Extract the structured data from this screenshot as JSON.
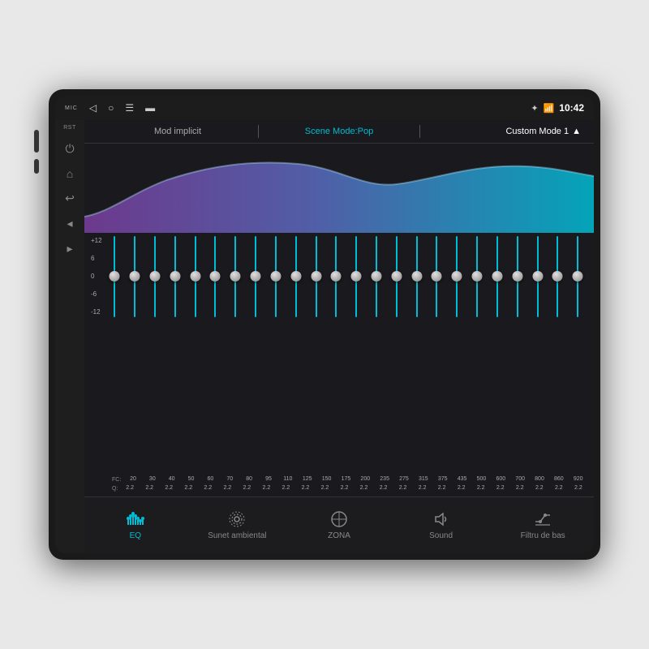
{
  "device": {
    "background": "#1a1a1a"
  },
  "status_bar": {
    "mic": "MIC",
    "time": "10:42",
    "nav_icons": [
      "◁",
      "○",
      "☰",
      "▬"
    ],
    "status_icons": [
      "✦",
      "☁",
      "📶"
    ]
  },
  "mode_bar": {
    "left": "Mod implicit",
    "center": "Scene Mode:Pop",
    "right": "Custom Mode 1",
    "right_arrow": "▲"
  },
  "left_sidebar": {
    "rst": "RST",
    "icons": [
      "⏻",
      "⌂",
      "↩",
      "↔",
      "↕"
    ]
  },
  "eq": {
    "db_labels": [
      "+12",
      "6",
      "0",
      "-6",
      "-12"
    ],
    "bands": [
      {
        "freq": "20",
        "q": "2.2",
        "position": 50
      },
      {
        "freq": "30",
        "q": "2.2",
        "position": 50
      },
      {
        "freq": "40",
        "q": "2.2",
        "position": 50
      },
      {
        "freq": "50",
        "q": "2.2",
        "position": 50
      },
      {
        "freq": "60",
        "q": "2.2",
        "position": 50
      },
      {
        "freq": "70",
        "q": "2.2",
        "position": 50
      },
      {
        "freq": "80",
        "q": "2.2",
        "position": 50
      },
      {
        "freq": "95",
        "q": "2.2",
        "position": 50
      },
      {
        "freq": "110",
        "q": "2.2",
        "position": 50
      },
      {
        "freq": "125",
        "q": "2.2",
        "position": 50
      },
      {
        "freq": "150",
        "q": "2.2",
        "position": 50
      },
      {
        "freq": "175",
        "q": "2.2",
        "position": 50
      },
      {
        "freq": "200",
        "q": "2.2",
        "position": 50
      },
      {
        "freq": "235",
        "q": "2.2",
        "position": 50
      },
      {
        "freq": "275",
        "q": "2.2",
        "position": 50
      },
      {
        "freq": "315",
        "q": "2.2",
        "position": 50
      },
      {
        "freq": "375",
        "q": "2.2",
        "position": 50
      },
      {
        "freq": "435",
        "q": "2.2",
        "position": 50
      },
      {
        "freq": "500",
        "q": "2.2",
        "position": 50
      },
      {
        "freq": "600",
        "q": "2.2",
        "position": 50
      },
      {
        "freq": "700",
        "q": "2.2",
        "position": 50
      },
      {
        "freq": "800",
        "q": "2.2",
        "position": 50
      },
      {
        "freq": "860",
        "q": "2.2",
        "position": 50
      },
      {
        "freq": "920",
        "q": "2.2",
        "position": 50
      }
    ]
  },
  "bottom_nav": {
    "tabs": [
      {
        "id": "eq",
        "label": "EQ",
        "icon": "eq",
        "active": true
      },
      {
        "id": "ambient",
        "label": "Sunet ambiental",
        "icon": "ambient",
        "active": false
      },
      {
        "id": "zona",
        "label": "ZONA",
        "icon": "zona",
        "active": false
      },
      {
        "id": "sound",
        "label": "Sound",
        "icon": "sound",
        "active": false
      },
      {
        "id": "bass",
        "label": "Filtru de bas",
        "icon": "bass",
        "active": false
      }
    ]
  }
}
